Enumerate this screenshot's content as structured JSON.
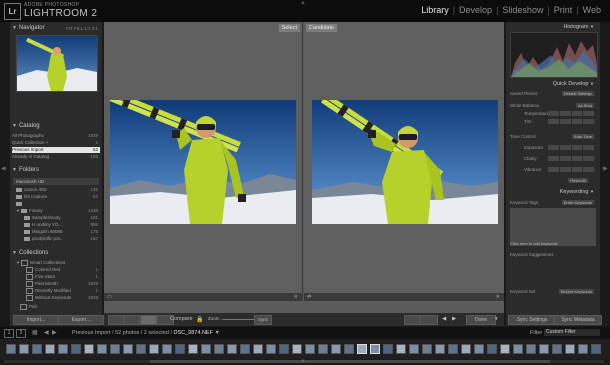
{
  "header": {
    "logo_badge": "Lr",
    "brand_top": "ADOBE PHOTOSHOP",
    "brand_name": "LIGHTROOM 2",
    "modules": [
      "Library",
      "Develop",
      "Slideshow",
      "Print",
      "Web"
    ],
    "active_module": "Library"
  },
  "left_panel": {
    "navigator_label": "Navigator",
    "navigator_controls": "FIT FILL 1:1 3:1",
    "catalog_label": "Catalog",
    "catalog_items": [
      {
        "label": "All Photographs",
        "count": "1929"
      },
      {
        "label": "Quick Collection +",
        "count": "1"
      },
      {
        "label": "Previous Import",
        "count": "52"
      },
      {
        "label": "Already In Catalog",
        "count": "105"
      }
    ],
    "folders_label": "Folders",
    "drive_label": "Macintosh HD",
    "drive_info": "",
    "folders": [
      {
        "label": "Canon 40D",
        "count": "136"
      },
      {
        "label": "D3 Capture",
        "count": "52"
      },
      {
        "label": "",
        "count": ""
      },
      {
        "label": "Fotosy",
        "count": "1438"
      },
      {
        "label": "Sampleshooty",
        "count": "181"
      },
      {
        "label": "H undilny YO...",
        "count": "896"
      },
      {
        "label": "Mingolin 60066",
        "count": "175"
      },
      {
        "label": "prodyktific pot...",
        "count": "157"
      }
    ],
    "collections_label": "Collections",
    "smart_collections_label": "Smart Collections",
    "collections": [
      {
        "label": "Colored Red",
        "count": "1"
      },
      {
        "label": "Five Stars",
        "count": "1"
      },
      {
        "label": "Past Month",
        "count": "1929"
      },
      {
        "label": "Recently Modified",
        "count": "1"
      },
      {
        "label": "Without Keywords",
        "count": "1929"
      }
    ],
    "last_collection": "Pick",
    "import_button": "Import...",
    "export_button": "Export..."
  },
  "center": {
    "select_tag": "Select",
    "candidate_tag": "Candidate",
    "toolbar": {
      "compare_label": "Compare",
      "zoom_label": "Zoom",
      "sync_label": "Sync",
      "done_button": "Done"
    }
  },
  "right_panel": {
    "histogram_label": "Histogram",
    "histogram_info": [
      "ISO 200",
      "24mm",
      "f/8",
      "1/320 sec"
    ],
    "quick_develop_label": "Quick Develop",
    "saved_preset_label": "Saved Preset",
    "saved_preset_value": "Default Settings",
    "white_balance_label": "White Balance",
    "white_balance_value": "As Shot",
    "tone_rows": [
      "Temperature",
      "Tint"
    ],
    "tone_control_label": "Tone Control",
    "tone_control_value": "Auto Tone",
    "exposure_rows": [
      "Exposure",
      "Clarity",
      "Vibrance"
    ],
    "reset_all": "Reset All",
    "keywording_label": "Keywording",
    "keyword_tags_label": "Keyword Tags",
    "keyword_tags_value": "Enter Keywords",
    "keyword_hint": "Click here to add keywords",
    "keyword_suggestions_label": "Keyword Suggestions",
    "keyword_set_label": "Keyword Set",
    "keyword_set_value": "Recent Keywords",
    "sync_settings_button": "Sync Settings",
    "sync_metadata_button": "Sync Metadata"
  },
  "filmbar": {
    "status": "Previous Import / 52 photos / 2 selected /",
    "filename": "DSC_9874.NEF",
    "filter_label": "Filter :",
    "filter_value": "Custom Filter",
    "page_1": "1",
    "page_2": "2"
  },
  "colors": {
    "accent_active": "#e4e4e4",
    "panel_bg": "#2b2b2b",
    "center_bg": "#5f5f5f",
    "sky": "#1e4d8c",
    "jacket": "#b7d12b"
  }
}
